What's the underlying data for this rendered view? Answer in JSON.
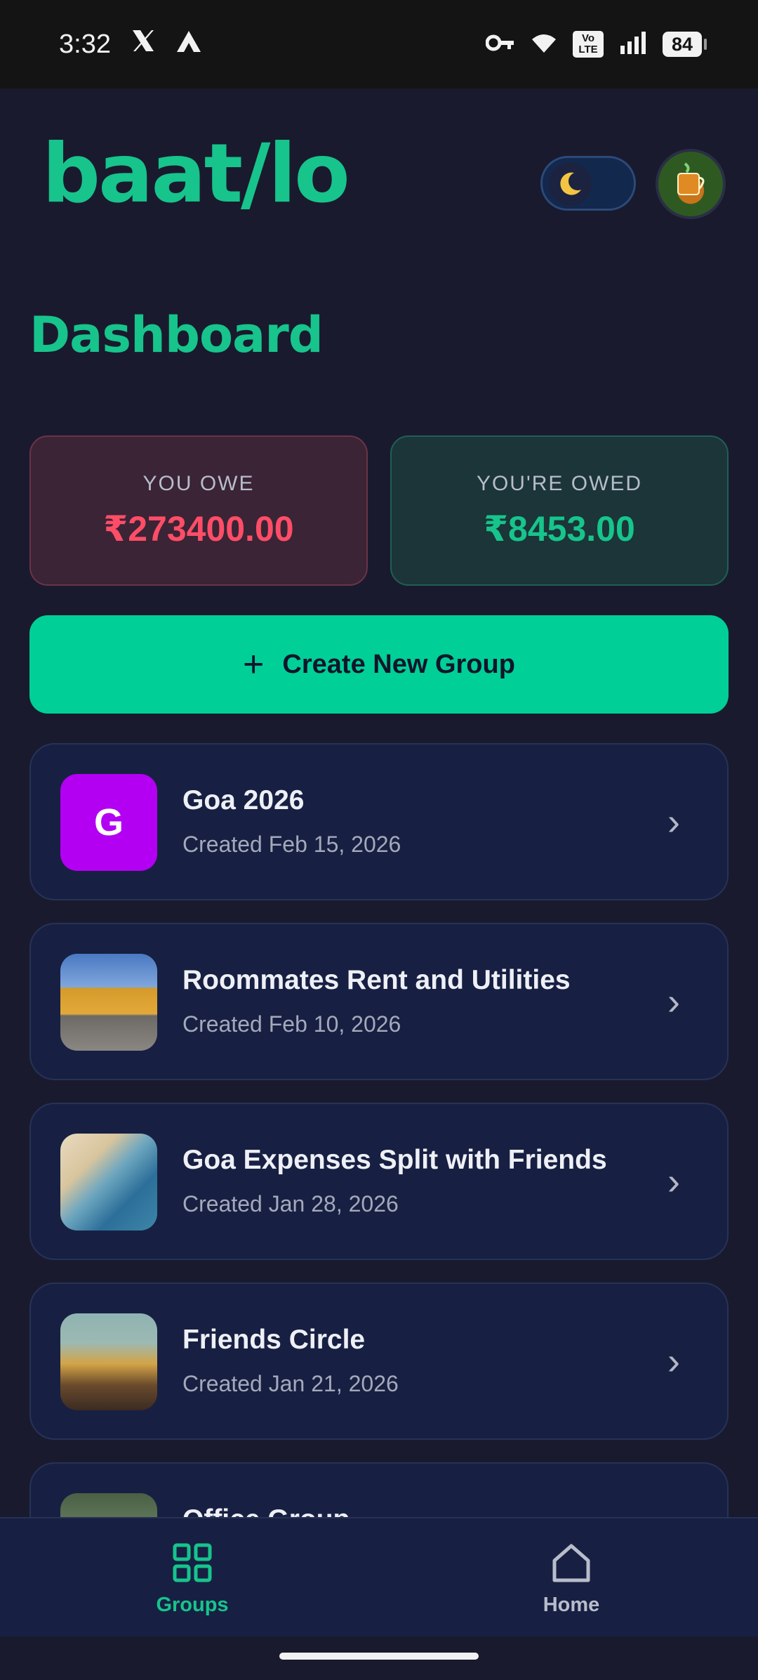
{
  "status_bar": {
    "time": "3:32",
    "left_icons": [
      "x-logo-icon",
      "delta-app-icon"
    ],
    "right_icons": [
      "vpn-key-icon",
      "wifi-icon",
      "volte-icon",
      "signal-icon",
      "battery-icon"
    ],
    "volte_text": "Vo\nLTE",
    "battery": "84"
  },
  "header": {
    "logo_text": "baat/lo",
    "theme_toggle_icon": "moon-icon",
    "avatar_icon": "tea-cup-icon"
  },
  "page": {
    "title": "Dashboard"
  },
  "summary": {
    "owe_label": "YOU OWE",
    "owe_value": "₹273400.00",
    "owed_label": "YOU'RE OWED",
    "owed_value": "₹8453.00"
  },
  "create_button": {
    "label": "Create New Group",
    "icon": "plus-icon"
  },
  "groups": [
    {
      "name": "Goa 2026",
      "created": "Created Feb 15, 2026",
      "thumb_letter": "G",
      "thumb_color": "#b300f2"
    },
    {
      "name": "Roommates Rent and Utilities",
      "created": "Created Feb 10, 2026",
      "thumb": "palace-photo"
    },
    {
      "name": "Goa Expenses Split with Friends",
      "created": "Created Jan 28, 2026",
      "thumb": "beach-photo"
    },
    {
      "name": "Friends Circle",
      "created": "Created Jan 21, 2026",
      "thumb": "friends-photo"
    },
    {
      "name": "Office Group",
      "created": "",
      "thumb": "office-photo"
    }
  ],
  "bottom_nav": {
    "items": [
      {
        "label": "Groups",
        "icon": "grid-icon",
        "active": true
      },
      {
        "label": "Home",
        "icon": "home-icon",
        "active": false
      }
    ]
  },
  "colors": {
    "accent": "#17c48c",
    "button": "#00cf98",
    "owe": "#ff4d67",
    "background": "#1a1a2e",
    "card": "#172042"
  }
}
